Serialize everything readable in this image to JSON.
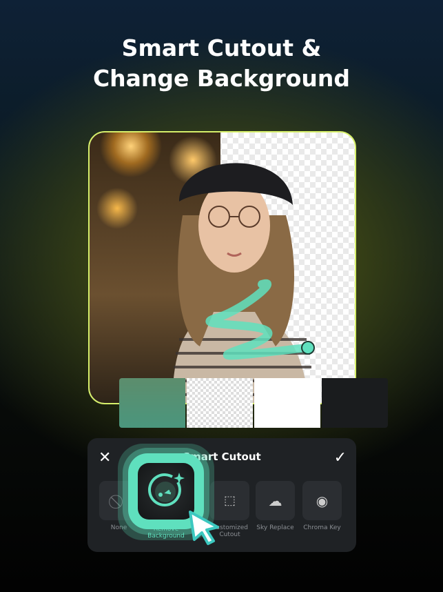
{
  "headline": {
    "line1": "Smart Cutout &",
    "line2": "Change Background"
  },
  "panel": {
    "title": "Smart Cutout",
    "close_icon": "close-icon",
    "confirm_icon": "check-icon",
    "tools": [
      {
        "label": "None",
        "icon": "none-icon"
      },
      {
        "label": "Remove Background",
        "icon": "remove-background-icon",
        "selected": true
      },
      {
        "label": "Customized Cutout",
        "icon": "customized-cutout-icon"
      },
      {
        "label": "Sky Replace",
        "icon": "sky-replace-icon"
      },
      {
        "label": "Chroma Key",
        "icon": "chroma-key-icon"
      }
    ]
  },
  "colors": {
    "accent": "#5fe0be",
    "border": "#d6ef6a",
    "panel": "#1f2225"
  }
}
